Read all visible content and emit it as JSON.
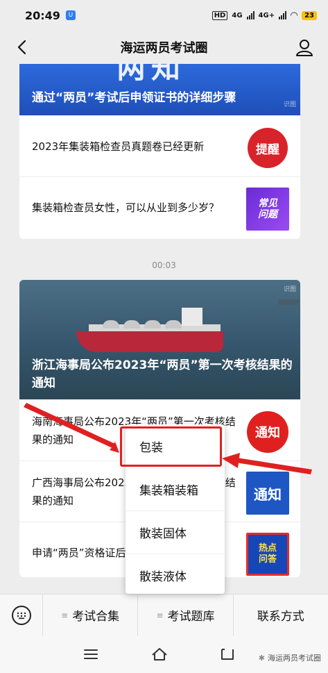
{
  "status": {
    "time": "20:49",
    "app_badge": "U",
    "net_hd": "HD",
    "net_4g_1": "4G",
    "net_4g_2": "4G+",
    "battery": "23"
  },
  "nav": {
    "title": "海运两员考试圈"
  },
  "card1": {
    "hero_big": "两知",
    "hero_title": "通过“两员”考试后申领证书的详细步骤",
    "watermark": "识图",
    "items": [
      {
        "text": "2023年集装箱检查员真题卷已经更新",
        "thumb": "提醒"
      },
      {
        "text": "集装箱检查员女性，可以从业到多少岁？",
        "thumb_line1": "常见",
        "thumb_line2": "问题"
      }
    ]
  },
  "time_label": "00:03",
  "card2": {
    "hero_title": "浙江海事局公布2023年“两员”第一次考核结果的通知",
    "watermark": "识图",
    "items": [
      {
        "text": "海南海事局公布2023年“两员”第一次考核结果的通知",
        "thumb": "通知"
      },
      {
        "text": "广西海事局公布2023年“两员”第一次考核结果的通知",
        "thumb": "通知"
      },
      {
        "text": "申请“两员”资格证后，多久可以拿证？",
        "thumb_line1": "热点",
        "thumb_line2": "问答"
      }
    ]
  },
  "popup": {
    "items": [
      "包装",
      "集装箱装箱",
      "散装固体",
      "散装液体"
    ]
  },
  "tabbar": {
    "tabs": [
      "考试合集",
      "考试题库",
      "联系方式"
    ]
  },
  "footer_watermark": "海运两员考试圈",
  "colors": {
    "highlight": "#e02020",
    "accent_blue": "#2e6de0"
  }
}
